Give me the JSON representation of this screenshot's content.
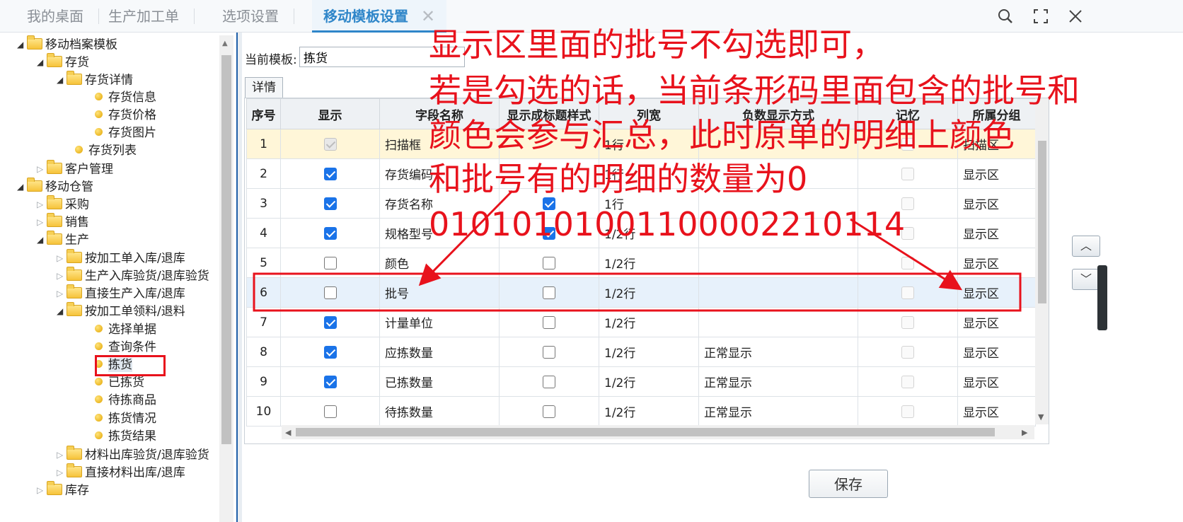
{
  "tabs": [
    {
      "label": "我的桌面",
      "active": false
    },
    {
      "label": "生产加工单",
      "active": false
    },
    {
      "label": "选项设置",
      "active": false
    },
    {
      "label": "移动模板设置",
      "active": true
    }
  ],
  "tab_close_glyph": "✕",
  "window_controls": [
    "search-icon",
    "maximize-icon",
    "close-icon"
  ],
  "tree": {
    "items": [
      {
        "label": "移动档案模板",
        "type": "folder",
        "expanded": true
      },
      {
        "label": "存货",
        "type": "folder",
        "expanded": true
      },
      {
        "label": "存货详情",
        "type": "folder",
        "expanded": true
      },
      {
        "label": "存货信息",
        "type": "leaf"
      },
      {
        "label": "存货价格",
        "type": "leaf"
      },
      {
        "label": "存货图片",
        "type": "leaf"
      },
      {
        "label": "存货列表",
        "type": "leaf"
      },
      {
        "label": "客户管理",
        "type": "folder",
        "expanded": false
      },
      {
        "label": "移动仓管",
        "type": "folder",
        "expanded": true
      },
      {
        "label": "采购",
        "type": "folder",
        "expanded": false
      },
      {
        "label": "销售",
        "type": "folder",
        "expanded": false
      },
      {
        "label": "生产",
        "type": "folder",
        "expanded": true
      },
      {
        "label": "按加工单入库/退库",
        "type": "folder",
        "expanded": false
      },
      {
        "label": "生产入库验货/退库验货",
        "type": "folder",
        "expanded": false
      },
      {
        "label": "直接生产入库/退库",
        "type": "folder",
        "expanded": false
      },
      {
        "label": "按加工单领料/退料",
        "type": "folder",
        "expanded": true
      },
      {
        "label": "选择单据",
        "type": "leaf"
      },
      {
        "label": "查询条件",
        "type": "leaf"
      },
      {
        "label": "拣货",
        "type": "leaf",
        "selected": true
      },
      {
        "label": "已拣货",
        "type": "leaf"
      },
      {
        "label": "待拣商品",
        "type": "leaf"
      },
      {
        "label": "拣货情况",
        "type": "leaf"
      },
      {
        "label": "拣货结果",
        "type": "leaf"
      },
      {
        "label": "材料出库验货/退库验货",
        "type": "folder",
        "expanded": false
      },
      {
        "label": "直接材料出库/退库",
        "type": "folder",
        "expanded": false
      },
      {
        "label": "库存",
        "type": "folder",
        "expanded": false
      }
    ]
  },
  "template": {
    "label": "当前模板:",
    "value": "拣货"
  },
  "detail_tab": "详情",
  "table": {
    "headers": [
      "序号",
      "显示",
      "字段名称",
      "显示成标题样式",
      "列宽",
      "负数显示方式",
      "记忆",
      "所属分组"
    ],
    "rows": [
      {
        "no": "1",
        "show": true,
        "show_disabled": true,
        "field": "扫描框",
        "title_style": null,
        "width": "1行",
        "negative": "",
        "memory": false,
        "group": "扫描区"
      },
      {
        "no": "2",
        "show": true,
        "field": "存货编码",
        "title_style": null,
        "width": "1行",
        "negative": "",
        "memory": false,
        "group": "显示区"
      },
      {
        "no": "3",
        "show": true,
        "field": "存货名称",
        "title_style": true,
        "width": "1行",
        "negative": "",
        "memory": false,
        "group": "显示区"
      },
      {
        "no": "4",
        "show": true,
        "field": "规格型号",
        "title_style": true,
        "width": "1/2行",
        "negative": "",
        "memory": false,
        "group": "显示区"
      },
      {
        "no": "5",
        "show": false,
        "field": "颜色",
        "title_style": false,
        "width": "1/2行",
        "negative": "",
        "memory": false,
        "group": "显示区"
      },
      {
        "no": "6",
        "show": false,
        "field": "批号",
        "title_style": false,
        "width": "1/2行",
        "negative": "",
        "memory": false,
        "group": "显示区"
      },
      {
        "no": "7",
        "show": true,
        "field": "计量单位",
        "title_style": false,
        "width": "1/2行",
        "negative": "",
        "memory": false,
        "group": "显示区"
      },
      {
        "no": "8",
        "show": true,
        "field": "应拣数量",
        "title_style": false,
        "width": "1/2行",
        "negative": "正常显示",
        "memory": false,
        "group": "显示区"
      },
      {
        "no": "9",
        "show": true,
        "field": "已拣数量",
        "title_style": false,
        "width": "1/2行",
        "negative": "正常显示",
        "memory": false,
        "group": "显示区"
      },
      {
        "no": "10",
        "show": false,
        "field": "待拣数量",
        "title_style": false,
        "width": "1/2行",
        "negative": "正常显示",
        "memory": false,
        "group": "显示区"
      }
    ]
  },
  "buttons": {
    "save": "保存",
    "move_up": "︿",
    "move_down": "﹀"
  },
  "annotation": {
    "lines": [
      "显示区里面的批号不勾选即可，",
      "若是勾选的话，当前条形码里面包含的批号和",
      "颜色会参与汇总，此时原单的明细上颜色",
      "和批号有的明细的数量为0",
      "01010101001100002210114"
    ],
    "color": "#e8121c"
  }
}
